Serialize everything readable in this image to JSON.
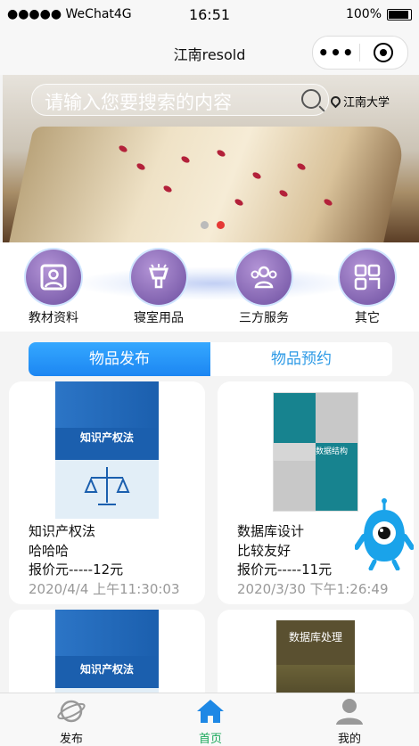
{
  "status": {
    "carrier": "●●●●● WeChat4G",
    "time": "16:51",
    "battery": "100%"
  },
  "nav": {
    "title": "江南resold"
  },
  "banner": {
    "search_placeholder": "请输入您要搜索的内容",
    "location": "江南大学"
  },
  "categories": [
    {
      "label": "教材资料",
      "icon": "portrait-icon"
    },
    {
      "label": "寝室用品",
      "icon": "lamp-icon"
    },
    {
      "label": "三方服务",
      "icon": "people-icon"
    },
    {
      "label": "其它",
      "icon": "grid-icon"
    }
  ],
  "tabs": [
    {
      "label": "物品发布"
    },
    {
      "label": "物品预约"
    }
  ],
  "items": [
    {
      "cover_title": "知识产权法",
      "title": "知识产权法",
      "desc": "哈哈哈",
      "price": "报价元-----12元",
      "date": "2020/4/4 上午11:30:03"
    },
    {
      "cover_title": "数据结构",
      "title": "数据库设计",
      "desc": "比较友好",
      "price": "报价元-----11元",
      "date": "2020/3/30 下午1:26:49"
    },
    {
      "cover_title": "知识产权法"
    },
    {
      "cover_title": "数据库处理"
    }
  ],
  "bottom_nav": [
    {
      "label": "发布"
    },
    {
      "label": "首页"
    },
    {
      "label": "我的"
    }
  ],
  "colors": {
    "accent": "#1c86f2",
    "tab_inactive": "#2d9ae6",
    "category": "#6d4fa0"
  }
}
